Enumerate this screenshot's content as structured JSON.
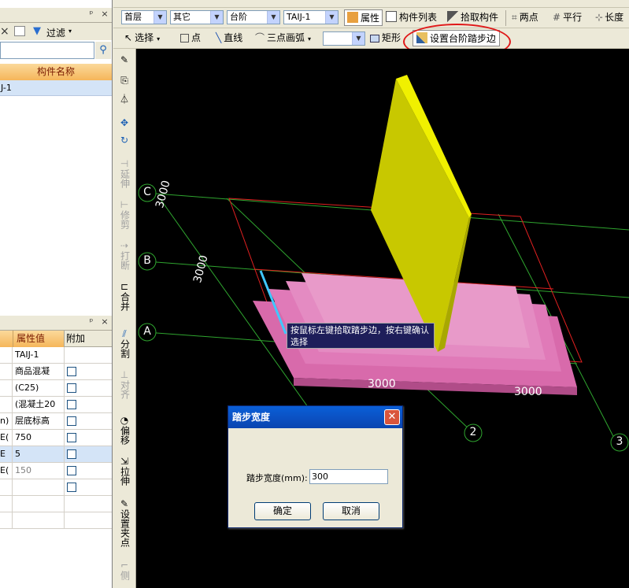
{
  "left_panel": {
    "filter_label": "过滤",
    "col_name_header": "构件名称",
    "list_item": "J-1",
    "props_header": "属性值",
    "extra_header": "附加",
    "rows": [
      {
        "key": "",
        "value": "TAIJ-1",
        "checkbox": false
      },
      {
        "key": "",
        "value": "商品混凝",
        "checkbox": true
      },
      {
        "key": "",
        "value": "(C25)",
        "checkbox": true
      },
      {
        "key": "",
        "value": "(混凝土20",
        "checkbox": true
      },
      {
        "key": "n)",
        "value": "层底标高",
        "checkbox": true
      },
      {
        "key": "E(",
        "value": "750",
        "checkbox": true
      },
      {
        "key": "E",
        "value": "5",
        "checkbox": true
      },
      {
        "key": "E(",
        "value": "150",
        "checkbox": true
      },
      {
        "key": "",
        "value": "",
        "checkbox": true
      },
      {
        "key": "",
        "value": "",
        "checkbox": false
      },
      {
        "key": "",
        "value": "",
        "checkbox": false
      }
    ]
  },
  "toolbar1": {
    "floor": "首层",
    "type": "其它",
    "component": "台阶",
    "name": "TAIJ-1",
    "properties": "属性",
    "component_list": "构件列表",
    "pick_component": "拾取构件",
    "two_points": "两点",
    "parallel": "平行",
    "length": "长度"
  },
  "toolbar2": {
    "select": "选择",
    "point": "点",
    "line": "直线",
    "arc": "三点画弧",
    "rect": "矩形",
    "set_step_edge": "设置台阶踏步边"
  },
  "vtools": {
    "extend": "延伸",
    "trim": "修剪",
    "break": "打断",
    "merge": "合并",
    "split": "分割",
    "align": "对齐",
    "offset": "偏移",
    "stretch": "拉伸",
    "set_grip": "设置夹点",
    "side": "侧"
  },
  "viewport": {
    "axis_c": "C",
    "axis_b": "B",
    "axis_a": "A",
    "axis_2": "2",
    "axis_3": "3",
    "dim_v1": "3000",
    "dim_v2": "3000",
    "dim_h1": "3000",
    "dim_h2": "3000",
    "tooltip": "按鼠标左键拾取踏步边，按右键确认选择"
  },
  "dialog": {
    "title": "踏步宽度",
    "label": "踏步宽度(mm):",
    "value": "300",
    "ok": "确定",
    "cancel": "取消"
  },
  "colors": {
    "step_pink": "#e07ab8",
    "wall_yellow": "#d4d400",
    "highlight_red": "#e02020",
    "grid_green": "#2fa52f"
  }
}
